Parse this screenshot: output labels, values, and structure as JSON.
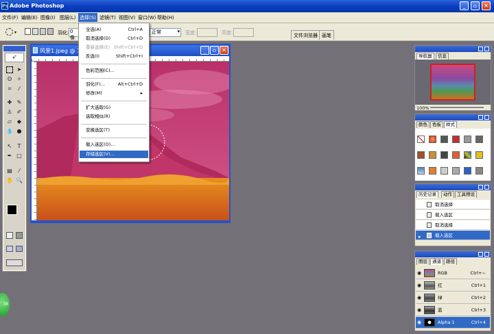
{
  "window": {
    "title": "Adobe Photoshop"
  },
  "menubar": [
    "文件(F)",
    "编辑(E)",
    "图像(I)",
    "图层(L)",
    "选择(S)",
    "滤镜(T)",
    "视图(V)",
    "窗口(W)",
    "帮助(H)"
  ],
  "options": {
    "feather_label": "羽化:",
    "feather_value": "0 像",
    "style_value": "正常",
    "width_label": "宽度:",
    "height_label": "高度:",
    "tab_browser": "文件浏览器",
    "tab_brushes": "画笔"
  },
  "document": {
    "title": "风景1.jpeg @ 1"
  },
  "select_menu": [
    {
      "label": "全选(A)",
      "shortcut": "Ctrl+A",
      "state": "normal"
    },
    {
      "label": "取消选择(D)",
      "shortcut": "Ctrl+D",
      "state": "normal"
    },
    {
      "label": "重新选择(E)",
      "shortcut": "Shift+Ctrl+D",
      "state": "disabled"
    },
    {
      "label": "反选(I)",
      "shortcut": "Shift+Ctrl+I",
      "state": "normal"
    },
    {
      "label": "色彩范围(C)...",
      "shortcut": "",
      "state": "normal"
    },
    {
      "label": "羽化(F)...",
      "shortcut": "Alt+Ctrl+D",
      "state": "normal"
    },
    {
      "label": "修改(M)",
      "shortcut": "▸",
      "state": "normal"
    },
    {
      "label": "扩大选取(G)",
      "shortcut": "",
      "state": "normal"
    },
    {
      "label": "选取相似(R)",
      "shortcut": "",
      "state": "normal"
    },
    {
      "label": "变换选区(T)",
      "shortcut": "",
      "state": "normal"
    },
    {
      "label": "载入选区(O)...",
      "shortcut": "",
      "state": "normal"
    },
    {
      "label": "存储选区(V)...",
      "shortcut": "",
      "state": "selected"
    }
  ],
  "navigator": {
    "tabs": [
      "导航器",
      "信息"
    ],
    "zoom": "100%"
  },
  "swatches_panel": {
    "tabs": [
      "颜色",
      "色板",
      "样式"
    ]
  },
  "history": {
    "tabs": [
      "历史记录",
      "动作",
      "工具预设"
    ],
    "items": [
      "取消选择",
      "载入选区",
      "取消选择",
      "载入选区"
    ]
  },
  "layers": {
    "tabs": [
      "图层",
      "通道",
      "路径"
    ],
    "channels": [
      {
        "name": "RGB",
        "shortcut": "Ctrl+~"
      },
      {
        "name": "红",
        "shortcut": "Ctrl+1"
      },
      {
        "name": "绿",
        "shortcut": "Ctrl+2"
      },
      {
        "name": "蓝",
        "shortcut": "Ctrl+3"
      },
      {
        "name": "Alpha 1",
        "shortcut": "Ctrl+4"
      }
    ]
  },
  "colors": {
    "accent": "#316ac5",
    "titlebar": "#0a3ec0",
    "workspace": "#747078"
  }
}
